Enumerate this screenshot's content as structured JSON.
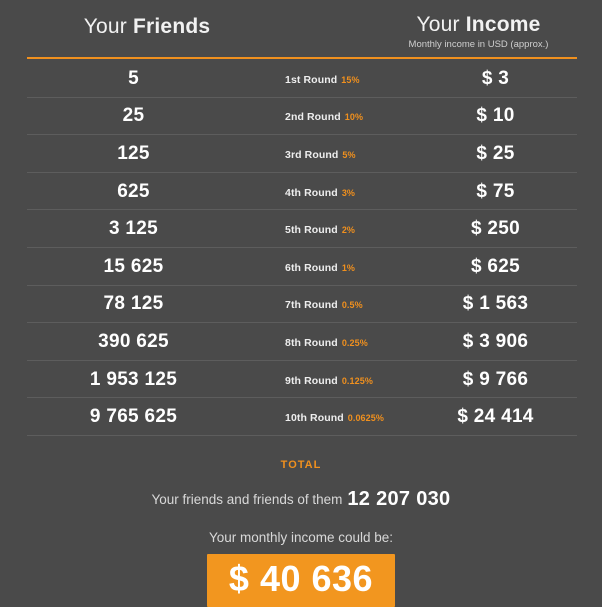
{
  "header": {
    "friends": {
      "light": "Your ",
      "bold": "Friends"
    },
    "income": {
      "light": "Your ",
      "bold": "Income",
      "subtitle": "Monthly income in USD (approx.)"
    }
  },
  "colors": {
    "background": "#4a4a4a",
    "accent": "#f0901e",
    "button": "#f2961f",
    "separator": "#5d5d5d",
    "text": "#ffffff"
  },
  "rows": [
    {
      "friends": "5",
      "round": "1st Round",
      "percent": "15%",
      "income": "$ 3"
    },
    {
      "friends": "25",
      "round": "2nd Round",
      "percent": "10%",
      "income": "$ 10"
    },
    {
      "friends": "125",
      "round": "3rd Round",
      "percent": "5%",
      "income": "$ 25"
    },
    {
      "friends": "625",
      "round": "4th Round",
      "percent": "3%",
      "income": "$ 75"
    },
    {
      "friends": "3 125",
      "round": "5th Round",
      "percent": "2%",
      "income": "$ 250"
    },
    {
      "friends": "15 625",
      "round": "6th Round",
      "percent": "1%",
      "income": "$ 625"
    },
    {
      "friends": "78 125",
      "round": "7th Round",
      "percent": "0.5%",
      "income": "$ 1 563"
    },
    {
      "friends": "390 625",
      "round": "8th Round",
      "percent": "0.25%",
      "income": "$ 3 906"
    },
    {
      "friends": "1 953 125",
      "round": "9th Round",
      "percent": "0.125%",
      "income": "$ 9 766"
    },
    {
      "friends": "9 765 625",
      "round": "10th Round",
      "percent": "0.0625%",
      "income": "$ 24 414"
    }
  ],
  "footer": {
    "total_label": "TOTAL",
    "friends_caption": "Your friends and friends of them",
    "friends_total": "12 207 030",
    "income_caption": "Your monthly income could be:",
    "income_total": "$ 40 636"
  }
}
